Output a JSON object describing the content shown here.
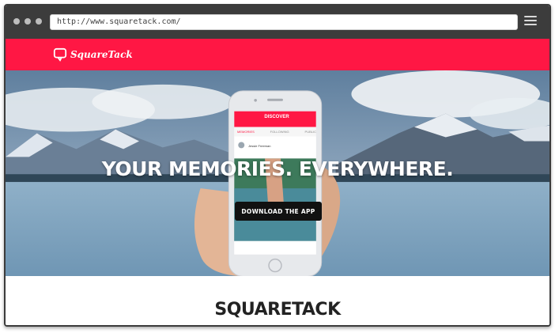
{
  "browser": {
    "url": "http://www.squaretack.com/"
  },
  "header": {
    "logo_text": "SquareTack"
  },
  "hero": {
    "headline": "YOUR MEMORIES. EVERYWHERE.",
    "cta_label": "DOWNLOAD THE APP"
  },
  "phone": {
    "title": "DISCOVER",
    "tabs": [
      "MEMORIES",
      "FOLLOWING",
      "PUBLIC"
    ],
    "post_author": "Jessie Freeman"
  },
  "section": {
    "title": "SQUARETACK"
  },
  "colors": {
    "brand": "#ff1744",
    "chrome": "#3c3c3c"
  }
}
